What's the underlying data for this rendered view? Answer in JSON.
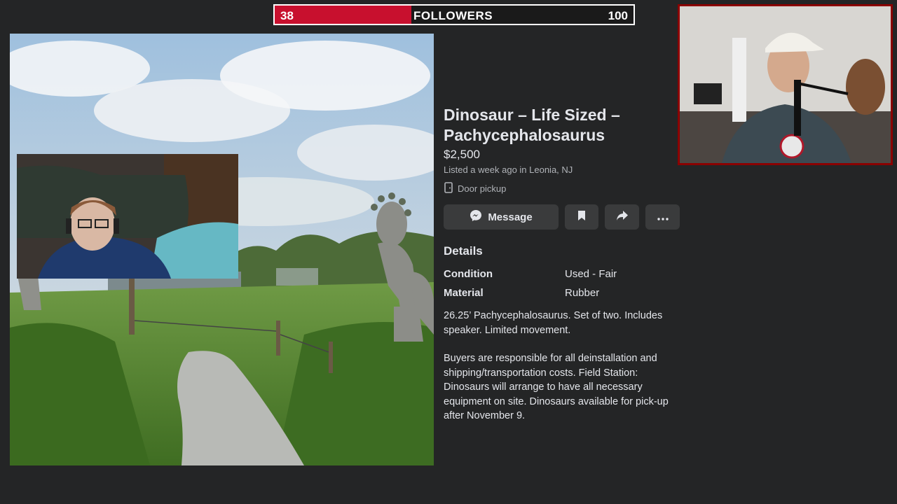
{
  "goal": {
    "current": "38",
    "label": "FOLLOWERS",
    "target": "100",
    "progress": 0.38
  },
  "listing": {
    "title": "Dinosaur – Life Sized – Pachycephalosaurus",
    "price": "$2,500",
    "listed": "Listed a week ago in Leonia, NJ",
    "pickup": "Door pickup",
    "buttons": {
      "message": "Message"
    },
    "details_heading": "Details",
    "details": [
      {
        "label": "Condition",
        "value": "Used - Fair"
      },
      {
        "label": "Material",
        "value": "Rubber"
      }
    ],
    "description": [
      "26.25’ Pachycephalosaurus. Set of two. Includes speaker. Limited movement.",
      "Buyers are responsible for all deinstallation and shipping/transportation costs. Field Station: Dinosaurs will arrange to have all necessary equipment on site. Dinosaurs available for pick-up after November 9."
    ]
  },
  "icons": {
    "pickup": "door-icon",
    "message": "messenger-icon",
    "save": "bookmark-icon",
    "share": "share-icon",
    "more": "more-icon"
  },
  "colors": {
    "goal_fill": "#c8102e",
    "background": "#242526",
    "button": "#3a3b3c",
    "webcam_border": "#8b0000"
  }
}
